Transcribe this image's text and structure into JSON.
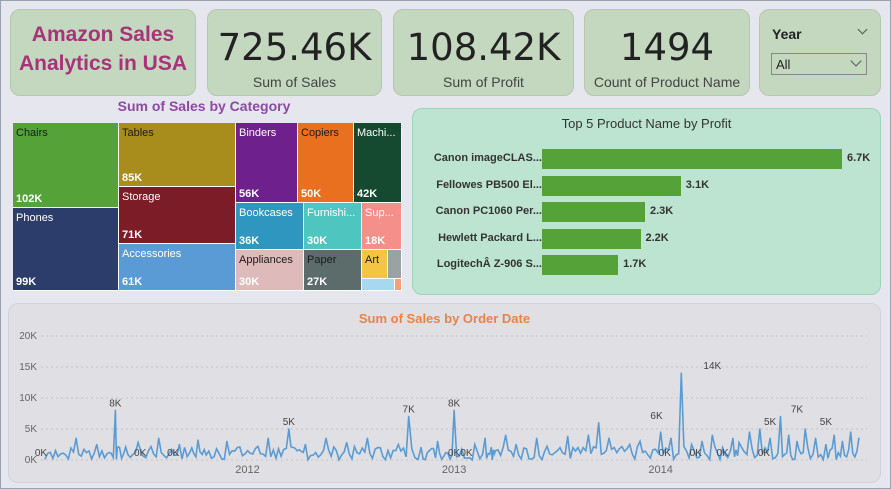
{
  "title": "Amazon Sales Analytics in USA",
  "kpis": [
    {
      "value": "725.46K",
      "label": "Sum of Sales"
    },
    {
      "value": "108.42K",
      "label": "Sum of Profit"
    },
    {
      "value": "1494",
      "label": "Count of Product Name"
    }
  ],
  "slicer": {
    "label": "Year",
    "selected": "All"
  },
  "colors": {
    "accent_title": "#a8337a",
    "kpi_card": "#c3d8bf",
    "bar": "#55a338",
    "line": "#5b9bd5",
    "treemap_title": "#8c4aa4",
    "line_title": "#e8824b"
  },
  "icons": {
    "slicer_clear": "chevron-down-icon",
    "dropdown": "chevron-down-icon"
  },
  "treemap": {
    "title": "Sum of Sales by Category",
    "tiles": [
      {
        "name": "Chairs",
        "value": "102K",
        "color": "#55a338"
      },
      {
        "name": "Phones",
        "value": "99K",
        "color": "#2c3d6b"
      },
      {
        "name": "Tables",
        "value": "85K",
        "color": "#a98d1c"
      },
      {
        "name": "Storage",
        "value": "71K",
        "color": "#7b1c27"
      },
      {
        "name": "Accessories",
        "value": "61K",
        "color": "#5b9bd5"
      },
      {
        "name": "Binders",
        "value": "56K",
        "color": "#6e218d"
      },
      {
        "name": "Copiers",
        "value": "50K",
        "color": "#e9701f"
      },
      {
        "name": "Machi...",
        "value": "42K",
        "color": "#164a30"
      },
      {
        "name": "Bookcases",
        "value": "36K",
        "color": "#2f96c0"
      },
      {
        "name": "Furnishi...",
        "value": "30K",
        "color": "#4ec6bf"
      },
      {
        "name": "Sup...",
        "value": "18K",
        "color": "#f58f8a"
      },
      {
        "name": "Appliances",
        "value": "30K",
        "color": "#dfbabb"
      },
      {
        "name": "Paper",
        "value": "27K",
        "color": "#5c6c6b"
      },
      {
        "name": "Art",
        "value": "",
        "color": "#f3c542"
      },
      {
        "name": "",
        "value": "",
        "color": "#9aa2a2"
      },
      {
        "name": "",
        "value": "",
        "color": "#a8d8ef"
      },
      {
        "name": "",
        "value": "",
        "color": "#f5a07b"
      }
    ]
  },
  "bar_chart": {
    "title": "Top 5 Product Name by Profit",
    "items": [
      {
        "name": "Canon imageCLAS...",
        "value": 6.7,
        "label": "6.7K"
      },
      {
        "name": "Fellowes PB500 El...",
        "value": 3.1,
        "label": "3.1K"
      },
      {
        "name": "Canon PC1060 Per...",
        "value": 2.3,
        "label": "2.3K"
      },
      {
        "name": "Hewlett Packard L...",
        "value": 2.2,
        "label": "2.2K"
      },
      {
        "name": "LogitechÂ Z-906 S...",
        "value": 1.7,
        "label": "1.7K"
      }
    ]
  },
  "chart_data": [
    {
      "type": "bar",
      "title": "Top 5 Product Name by Profit",
      "categories": [
        "Canon imageCLAS...",
        "Fellowes PB500 El...",
        "Canon PC1060 Per...",
        "Hewlett Packard L...",
        "LogitechÂ Z-906 S..."
      ],
      "values": [
        6.7,
        3.1,
        2.3,
        2.2,
        1.7
      ],
      "unit": "K"
    },
    {
      "type": "line",
      "title": "Sum of Sales by Order Date",
      "yticks": [
        "0K",
        "5K",
        "10K",
        "15K",
        "20K"
      ],
      "ylim": [
        0,
        20
      ],
      "xticks": [
        "2012",
        "2013",
        "2014"
      ],
      "xlim": [
        2011,
        2014.999
      ],
      "grid": true,
      "x": [
        2011.02,
        2011.07,
        2011.12,
        2011.17,
        2011.22,
        2011.27,
        2011.32,
        2011.36,
        2011.38,
        2011.42,
        2011.47,
        2011.52,
        2011.57,
        2011.62,
        2011.67,
        2011.72,
        2011.76,
        2011.8,
        2011.85,
        2011.9,
        2011.95,
        2012.0,
        2012.05,
        2012.1,
        2012.15,
        2012.2,
        2012.24,
        2012.28,
        2012.33,
        2012.38,
        2012.43,
        2012.48,
        2012.53,
        2012.58,
        2012.63,
        2012.68,
        2012.73,
        2012.78,
        2012.84,
        2012.88,
        2012.92,
        2012.96,
        2013.0,
        2013.05,
        2013.1,
        2013.15,
        2013.18,
        2013.2,
        2013.25,
        2013.3,
        2013.35,
        2013.4,
        2013.45,
        2013.5,
        2013.55,
        2013.6,
        2013.65,
        2013.7,
        2013.75,
        2013.8,
        2013.85,
        2013.9,
        2013.95,
        2014.0,
        2014.05,
        2014.1,
        2014.15,
        2014.2,
        2014.25,
        2014.3,
        2014.35,
        2014.38,
        2014.43,
        2014.48,
        2014.53,
        2014.58,
        2014.62,
        2014.66,
        2014.7,
        2014.75,
        2014.8,
        2014.84,
        2014.88,
        2014.92,
        2014.96
      ],
      "y": [
        0.2,
        1.5,
        0.8,
        3.5,
        1.2,
        2.5,
        1.0,
        8.0,
        2.0,
        0.9,
        2.8,
        1.5,
        3.5,
        1.0,
        2.5,
        1.2,
        3.2,
        0.8,
        1.8,
        3.0,
        2.0,
        1.5,
        2.2,
        3.5,
        1.8,
        5.0,
        1.5,
        2.5,
        1.2,
        3.5,
        1.5,
        2.8,
        1.2,
        3.5,
        2.0,
        1.5,
        2.5,
        7.0,
        2.0,
        1.5,
        3.0,
        1.2,
        8.0,
        0.3,
        2.5,
        3.5,
        2.0,
        1.5,
        4.0,
        2.5,
        1.8,
        3.5,
        2.2,
        1.5,
        3.8,
        2.0,
        4.0,
        6.0,
        3.5,
        1.8,
        2.5,
        3.0,
        0.3,
        4.5,
        3.5,
        14.0,
        2.5,
        3.0,
        4.0,
        2.0,
        3.5,
        2.8,
        4.5,
        5.0,
        3.5,
        7.0,
        4.0,
        3.0,
        5.0,
        3.5,
        2.5,
        4.0,
        3.0,
        4.5,
        3.5
      ],
      "data_labels": [
        {
          "x": 2011.0,
          "y": 0,
          "text": "0K"
        },
        {
          "x": 2011.36,
          "y": 8,
          "text": "8K"
        },
        {
          "x": 2011.48,
          "y": 0,
          "text": "0K"
        },
        {
          "x": 2011.64,
          "y": 0,
          "text": "0K"
        },
        {
          "x": 2012.2,
          "y": 5,
          "text": "5K"
        },
        {
          "x": 2012.78,
          "y": 7,
          "text": "7K"
        },
        {
          "x": 2013.0,
          "y": 8,
          "text": "8K"
        },
        {
          "x": 2013.0,
          "y": 0,
          "text": "0K"
        },
        {
          "x": 2013.06,
          "y": 0,
          "text": "0K"
        },
        {
          "x": 2013.98,
          "y": 6,
          "text": "6K"
        },
        {
          "x": 2014.02,
          "y": 0,
          "text": "0K"
        },
        {
          "x": 2014.17,
          "y": 0,
          "text": "0K"
        },
        {
          "x": 2014.25,
          "y": 14,
          "text": "14K"
        },
        {
          "x": 2014.3,
          "y": 0,
          "text": "0K"
        },
        {
          "x": 2014.5,
          "y": 0,
          "text": "0K"
        },
        {
          "x": 2014.53,
          "y": 5,
          "text": "5K"
        },
        {
          "x": 2014.66,
          "y": 7,
          "text": "7K"
        },
        {
          "x": 2014.8,
          "y": 5,
          "text": "5K"
        }
      ]
    },
    {
      "type": "treemap",
      "title": "Sum of Sales by Category",
      "categories": [
        "Chairs",
        "Phones",
        "Tables",
        "Storage",
        "Accessories",
        "Binders",
        "Copiers",
        "Machi...",
        "Bookcases",
        "Furnishi...",
        "Sup...",
        "Appliances",
        "Paper",
        "Art"
      ],
      "values": [
        102,
        99,
        85,
        71,
        61,
        56,
        50,
        42,
        36,
        30,
        18,
        30,
        27,
        null
      ],
      "unit": "K"
    }
  ]
}
